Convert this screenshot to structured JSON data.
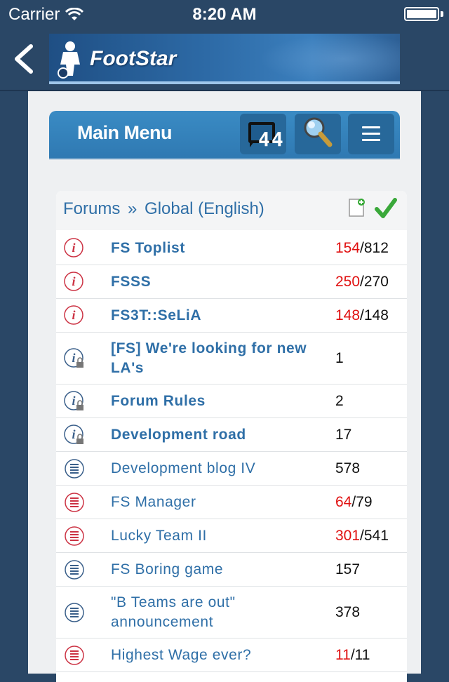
{
  "status": {
    "carrier": "Carrier",
    "time": "8:20 AM"
  },
  "header": {
    "logo_text": "FootStar"
  },
  "colors": {
    "page_bg": "#2a4766",
    "accent": "#2f79b2",
    "link": "#2f6fa7",
    "new_count": "#e01010"
  },
  "main_menu": {
    "title": "Main Menu",
    "message_count": "44"
  },
  "forum": {
    "breadcrumb_root": "Forums",
    "breadcrumb_sep": "»",
    "breadcrumb_current": "Global (English)",
    "rows": [
      {
        "icon": "info-icon",
        "title": "FS Toplist",
        "bold": true,
        "count_new": "154",
        "count_total": "/812"
      },
      {
        "icon": "info-icon",
        "title": "FSSS",
        "bold": true,
        "count_new": "250",
        "count_total": "/270"
      },
      {
        "icon": "info-icon",
        "title": "FS3T::SeLiA",
        "bold": true,
        "count_new": "148",
        "count_total": "/148"
      },
      {
        "icon": "locked-info-icon",
        "title": "[FS] We're looking for new LA's",
        "bold": true,
        "count_new": "",
        "count_total": "1"
      },
      {
        "icon": "locked-info-icon",
        "title": "Forum Rules",
        "bold": true,
        "count_new": "",
        "count_total": "2"
      },
      {
        "icon": "locked-info-icon",
        "title": "Development road",
        "bold": true,
        "count_new": "",
        "count_total": "17"
      },
      {
        "icon": "thread-icon",
        "title": "Development blog IV",
        "bold": false,
        "count_new": "",
        "count_total": "578"
      },
      {
        "icon": "new-thread-icon",
        "title": "FS Manager",
        "bold": false,
        "count_new": "64",
        "count_total": "/79"
      },
      {
        "icon": "new-thread-icon",
        "title": "Lucky Team II",
        "bold": false,
        "count_new": "301",
        "count_total": "/541"
      },
      {
        "icon": "thread-icon",
        "title": "FS Boring game",
        "bold": false,
        "count_new": "",
        "count_total": "157"
      },
      {
        "icon": "thread-icon",
        "title": "\"B Teams are out\" announcement",
        "bold": false,
        "count_new": "",
        "count_total": "378"
      },
      {
        "icon": "new-thread-icon",
        "title": "Highest Wage ever?",
        "bold": false,
        "count_new": "11",
        "count_total": "/11"
      }
    ]
  }
}
